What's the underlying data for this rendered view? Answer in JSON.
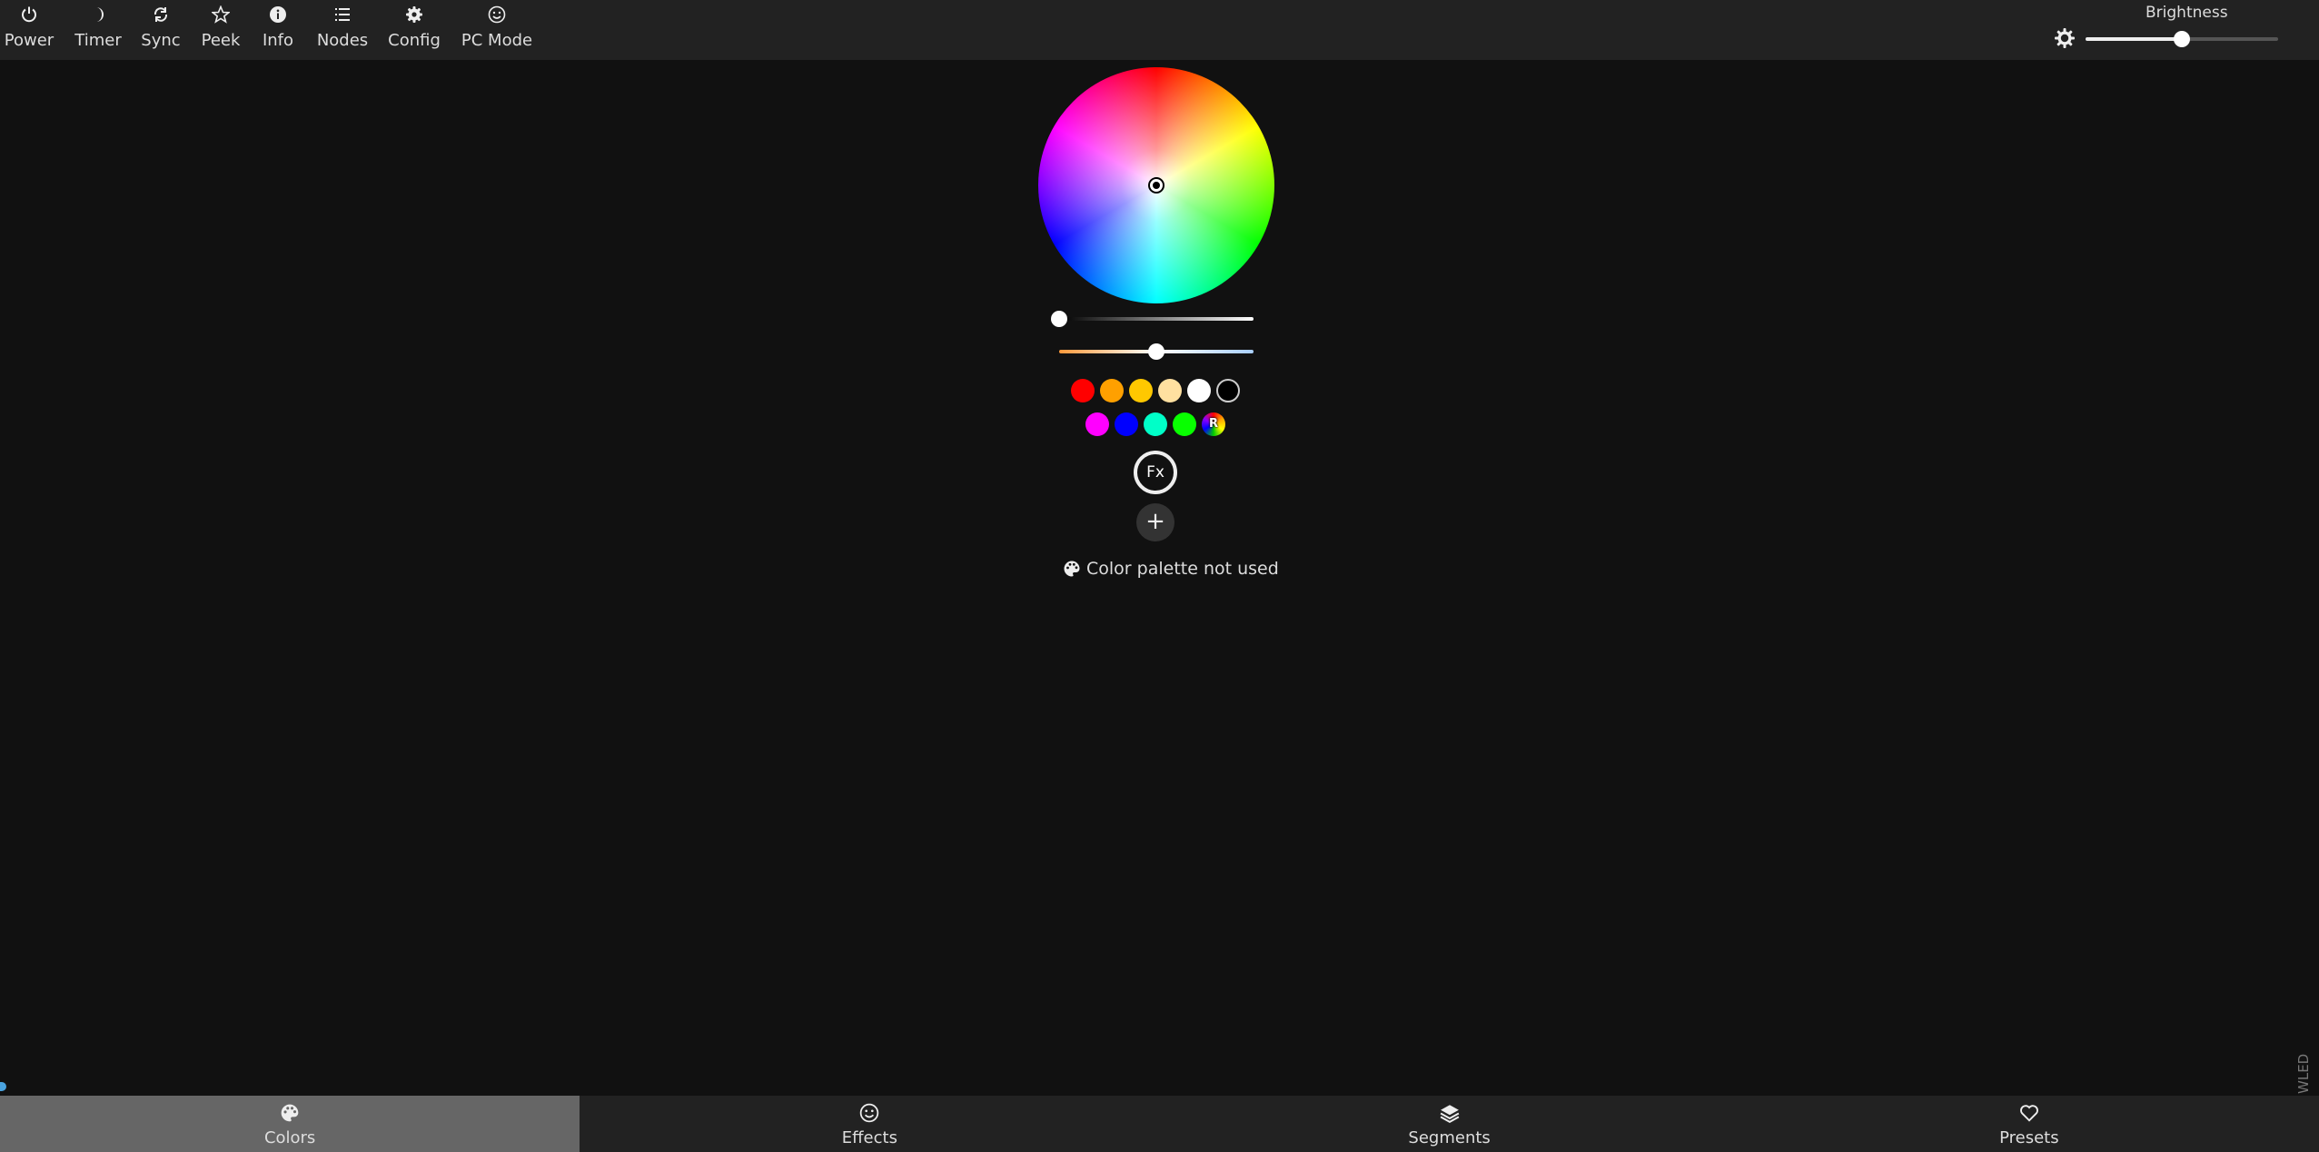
{
  "toolbar": {
    "items": [
      {
        "label": "Power",
        "icon": "power-icon"
      },
      {
        "label": "Timer",
        "icon": "moon-icon"
      },
      {
        "label": "Sync",
        "icon": "sync-icon"
      },
      {
        "label": "Peek",
        "icon": "star-icon"
      },
      {
        "label": "Info",
        "icon": "info-icon"
      },
      {
        "label": "Nodes",
        "icon": "list-icon"
      },
      {
        "label": "Config",
        "icon": "gear-icon"
      },
      {
        "label": "PC Mode",
        "icon": "smiley-icon"
      }
    ]
  },
  "brightness": {
    "label": "Brightness",
    "value": 0.5
  },
  "color_picker": {
    "value_slider": 0.0,
    "cct_slider": 0.5
  },
  "quick_colors": {
    "row1": [
      "#ff0000",
      "#ffa000",
      "#ffc800",
      "#ffe0a0",
      "#ffffff",
      "#000000"
    ],
    "row2": [
      "#ff00ff",
      "#0000ff",
      "#00ffc8",
      "#08ff00"
    ],
    "random_label": "R"
  },
  "fx_label": "Fx",
  "add_label": "+",
  "palette_note": "Color palette not used",
  "logo_text": "WLED",
  "colors": {
    "background": "#111111",
    "bar": "#222222",
    "active_tab": "#666666",
    "text": "#dddddd"
  },
  "bottom_tabs": [
    {
      "label": "Colors",
      "icon": "palette-icon",
      "active": true
    },
    {
      "label": "Effects",
      "icon": "smiley-icon",
      "active": false
    },
    {
      "label": "Segments",
      "icon": "layers-icon",
      "active": false
    },
    {
      "label": "Presets",
      "icon": "heart-icon",
      "active": false
    }
  ]
}
